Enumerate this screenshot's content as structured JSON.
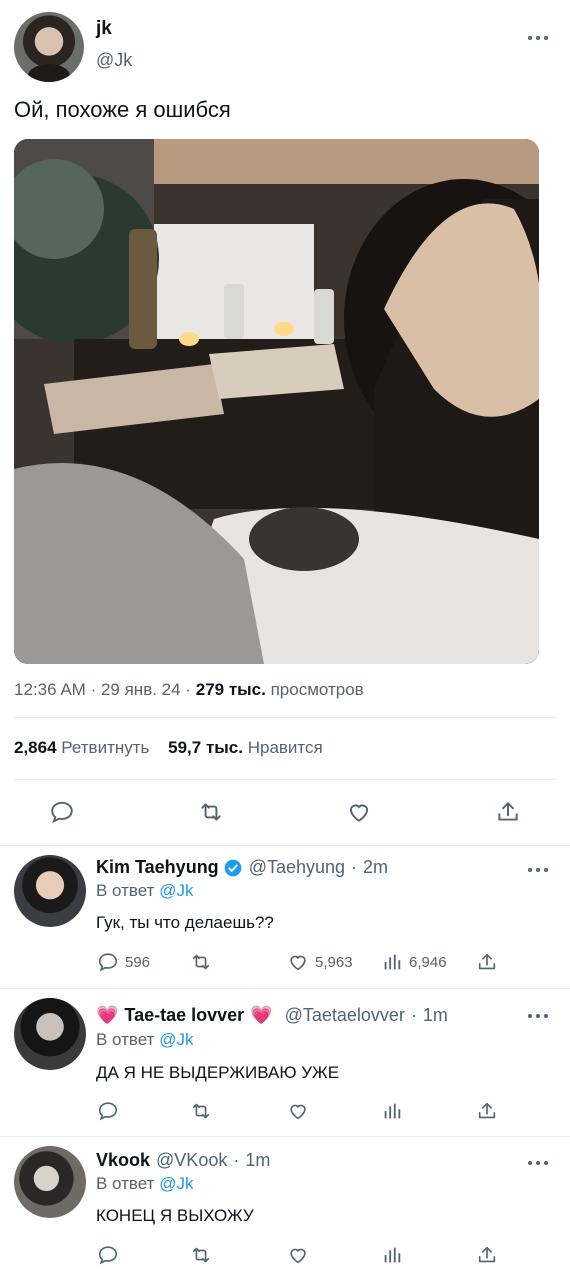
{
  "main_tweet": {
    "display_name": "jk",
    "handle": "@Jk",
    "text": "Ой, похоже я ошибся",
    "time": "12:36 AM",
    "date": "29 янв. 24",
    "views_count": "279 тыс.",
    "views_label": "просмотров",
    "retweets_count": "2,864",
    "retweets_label": "Ретвитнуть",
    "likes_count": "59,7 тыс.",
    "likes_label": "Нравится"
  },
  "separator": "·",
  "replies": [
    {
      "display_name": "Kim Taehyung",
      "verified": true,
      "handle": "@Taehyung",
      "time": "2m",
      "reply_prefix": "В ответ",
      "reply_to": "@Jk",
      "text": "Гук, ты что делаешь??",
      "reply_count": "596",
      "like_count": "5,963",
      "view_count": "6,946"
    },
    {
      "display_name": "Tae-tae lovver",
      "name_emoji": "💗",
      "handle": "@Taetaelovver",
      "time": "1m",
      "reply_prefix": "В ответ",
      "reply_to": "@Jk",
      "text": "ДА Я НЕ ВЫДЕРЖИВАЮ УЖЕ"
    },
    {
      "display_name": "Vkook",
      "handle": "@VKook",
      "time": "1m",
      "reply_prefix": "В ответ",
      "reply_to": "@Jk",
      "text": "КОНЕЦ Я ВЫХОЖУ"
    }
  ],
  "colors": {
    "link": "#1d9bf0",
    "secondary_text": "#536471",
    "primary_text": "#0f1419",
    "divider": "#e6ecf0",
    "emoji_heart": "#f04584"
  },
  "icons": [
    "more-icon",
    "reply-icon",
    "retweet-icon",
    "like-icon",
    "share-icon",
    "views-icon",
    "verified-icon"
  ]
}
